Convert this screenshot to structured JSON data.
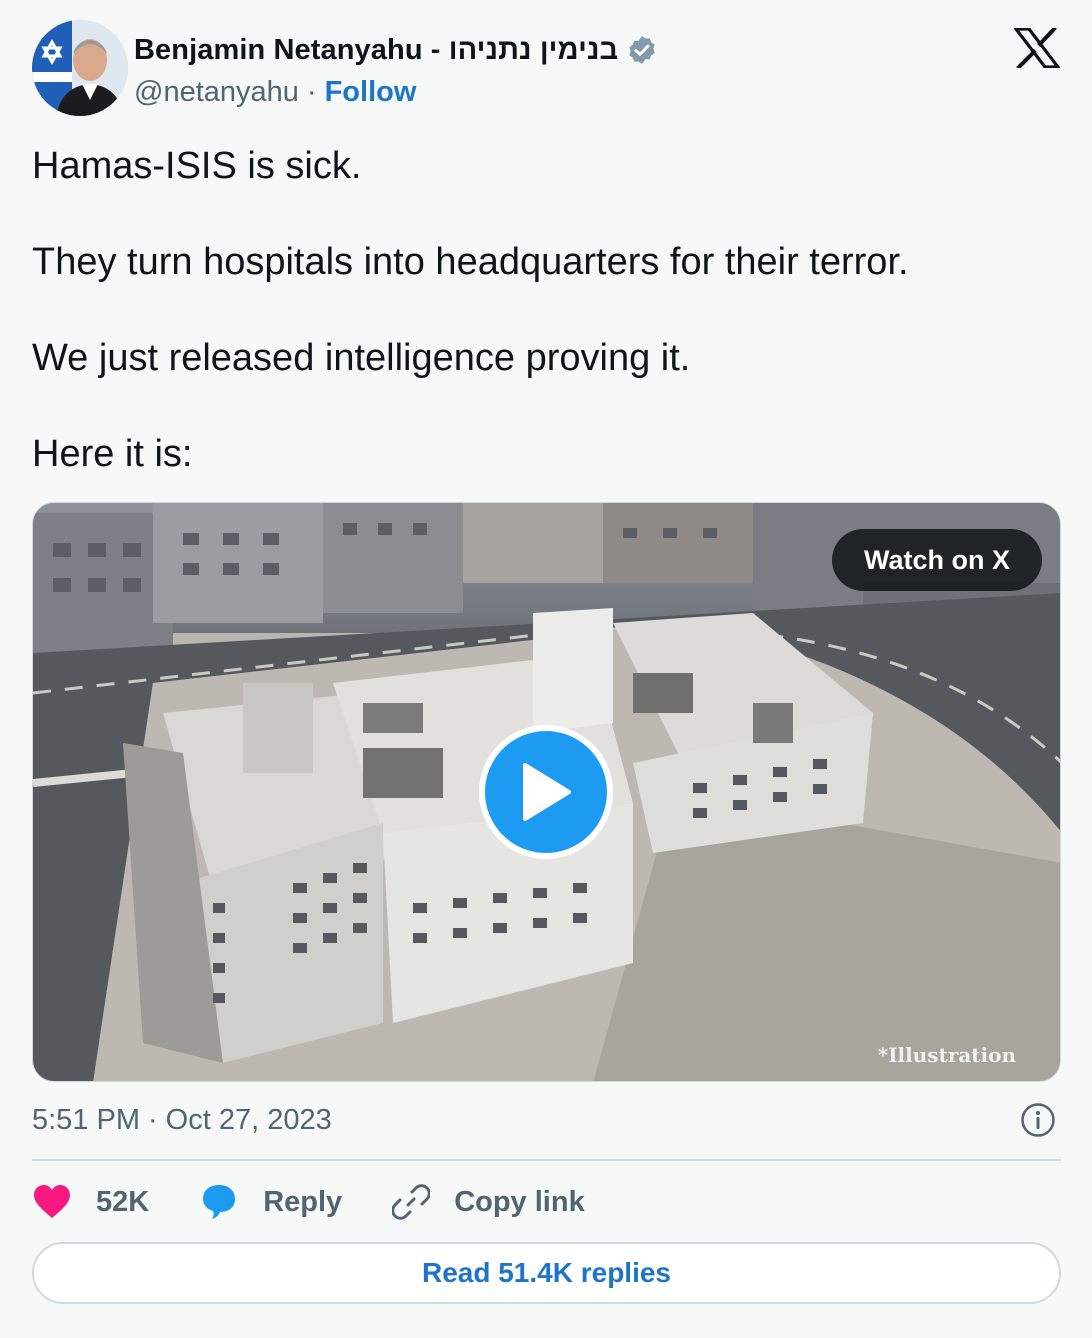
{
  "author": {
    "display_name": "Benjamin Netanyahu - בנימין נתניהו",
    "handle": "@netanyahu",
    "separator": "·",
    "follow_label": "Follow",
    "verified_icon": "verified-badge-icon",
    "avatar_icon": "avatar-flag-portrait"
  },
  "brand_icon": "x-logo-icon",
  "tweet": {
    "paragraphs": [
      "Hamas-ISIS is sick.",
      "They turn hospitals into headquarters for their terror.",
      "We just released intelligence proving it.",
      "Here it is:"
    ]
  },
  "media": {
    "watch_label": "Watch on X",
    "play_icon": "play-icon",
    "caption": "*Illustration"
  },
  "meta": {
    "time": "5:51 PM",
    "separator": "·",
    "date": "Oct 27, 2023",
    "info_icon": "info-icon"
  },
  "actions": {
    "like_count": "52K",
    "reply_label": "Reply",
    "copy_label": "Copy link"
  },
  "read_replies_label": "Read 51.4K replies",
  "colors": {
    "accent_blue": "#1d9bf0",
    "link_blue": "#1d74c9",
    "like_pink": "#f91880",
    "muted_text": "#536471"
  }
}
